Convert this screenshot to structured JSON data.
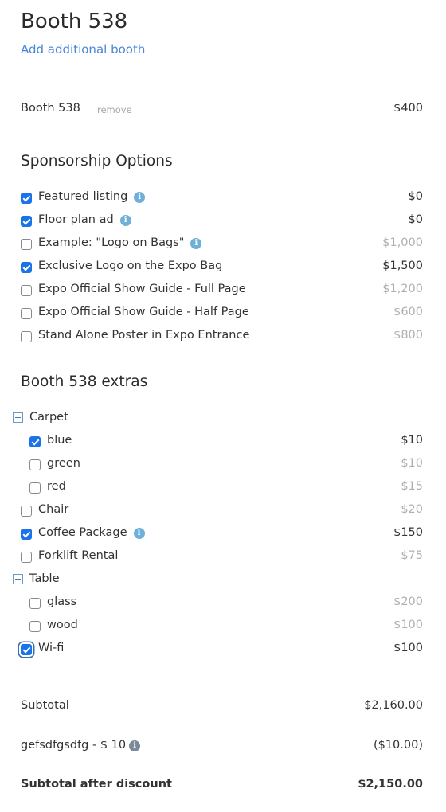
{
  "header": {
    "title": "Booth 538",
    "add_link": "Add additional booth"
  },
  "booth": {
    "name": "Booth 538",
    "remove_label": "remove",
    "price": "$400"
  },
  "sponsorship": {
    "title": "Sponsorship Options",
    "items": [
      {
        "label": "Featured listing",
        "price": "$0",
        "checked": true,
        "info": true
      },
      {
        "label": "Floor plan ad",
        "price": "$0",
        "checked": true,
        "info": true
      },
      {
        "label": "Example: \"Logo on Bags\"",
        "price": "$1,000",
        "checked": false,
        "info": true
      },
      {
        "label": "Exclusive Logo on the Expo Bag",
        "price": "$1,500",
        "checked": true,
        "info": false
      },
      {
        "label": "Expo Official Show Guide - Full Page",
        "price": "$1,200",
        "checked": false,
        "info": false
      },
      {
        "label": "Expo Official Show Guide - Half Page",
        "price": "$600",
        "checked": false,
        "info": false
      },
      {
        "label": "Stand Alone Poster in Expo Entrance",
        "price": "$800",
        "checked": false,
        "info": false
      }
    ]
  },
  "extras": {
    "title": "Booth 538 extras",
    "groups": [
      {
        "name": "Carpet",
        "items": [
          {
            "label": "blue",
            "price": "$10",
            "checked": true
          },
          {
            "label": "green",
            "price": "$10",
            "checked": false
          },
          {
            "label": "red",
            "price": "$15",
            "checked": false
          }
        ]
      },
      {
        "item": {
          "label": "Chair",
          "price": "$20",
          "checked": false
        }
      },
      {
        "item": {
          "label": "Coffee Package",
          "price": "$150",
          "checked": true,
          "info": true
        }
      },
      {
        "item": {
          "label": "Forklift Rental",
          "price": "$75",
          "checked": false
        }
      },
      {
        "name": "Table",
        "items": [
          {
            "label": "glass",
            "price": "$200",
            "checked": false
          },
          {
            "label": "wood",
            "price": "$100",
            "checked": false
          }
        ]
      },
      {
        "item": {
          "label": "Wi-fi",
          "price": "$100",
          "checked": true,
          "focused": true
        }
      }
    ]
  },
  "summary": {
    "subtotal_label": "Subtotal",
    "subtotal_value": "$2,160.00",
    "discount_label": "gefsdfgsdfg - $ 10",
    "discount_value": "($10.00)",
    "after_label": "Subtotal after discount",
    "after_value": "$2,150.00"
  },
  "colors": {
    "accent": "#1a73e8",
    "link": "#4a86d8",
    "info": "#6fb0d8",
    "muted_price": "#b0b0b0"
  }
}
